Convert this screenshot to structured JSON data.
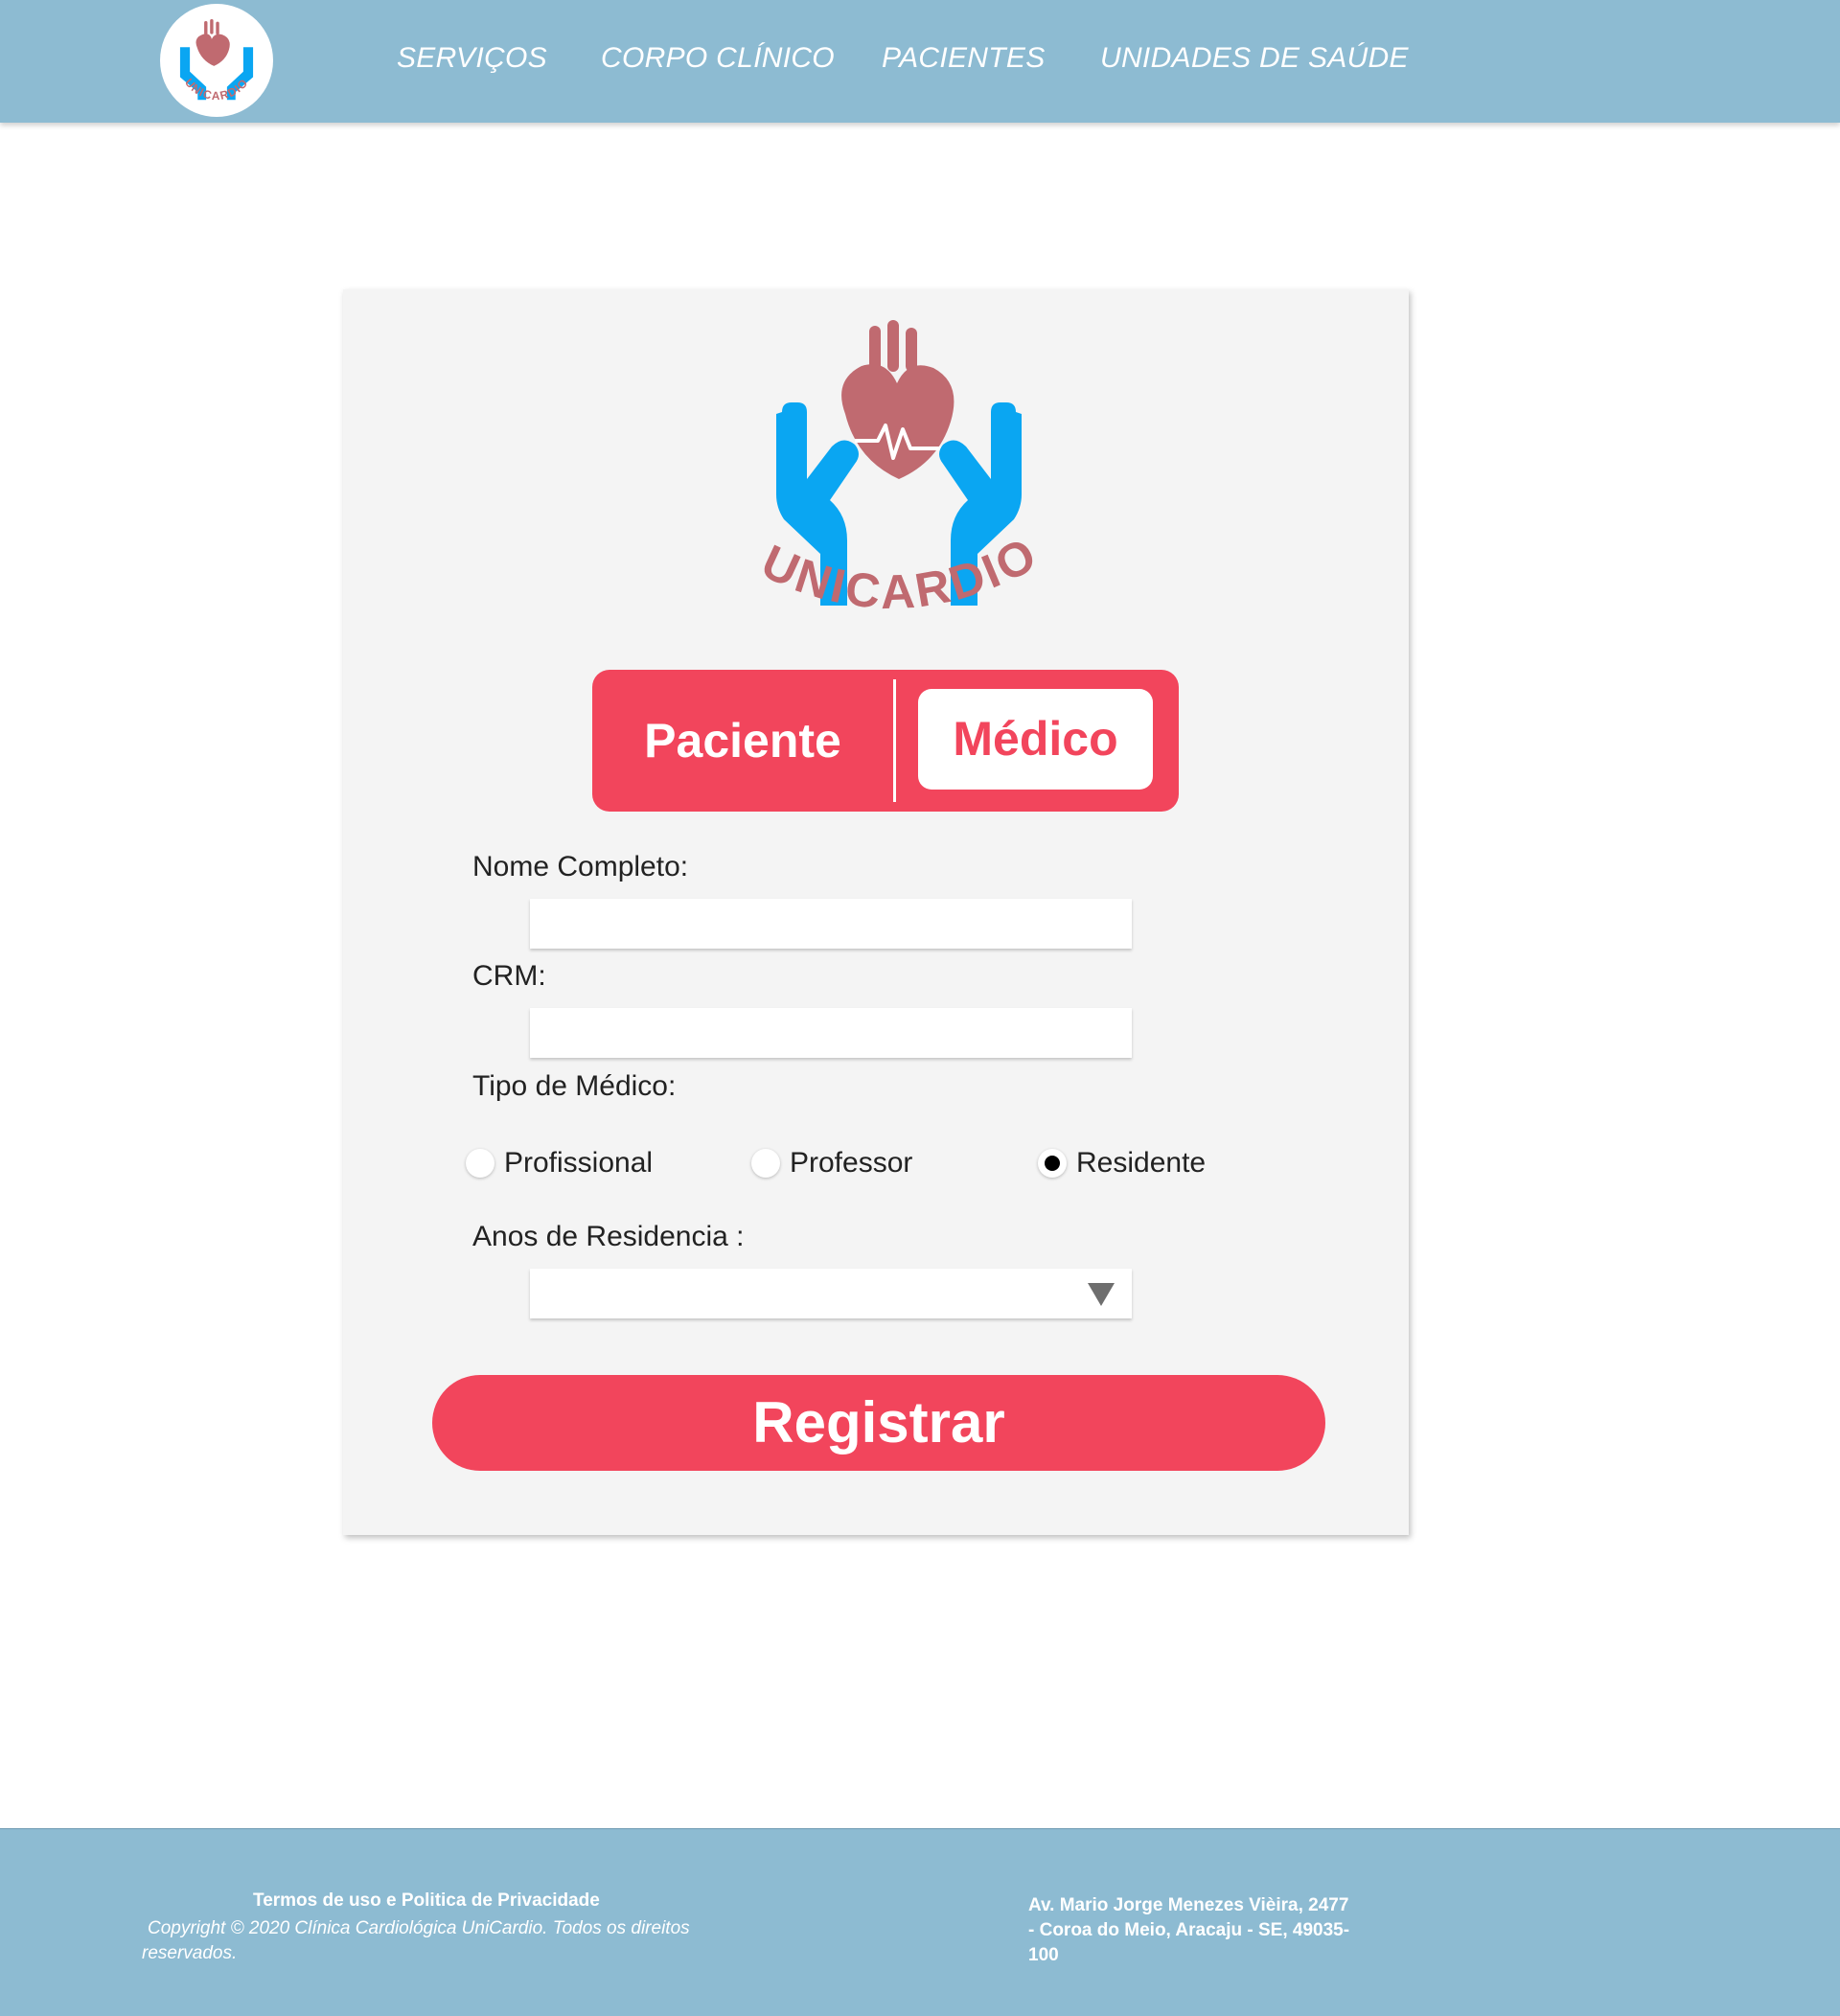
{
  "brand": {
    "logo_text": "UNICARDIO",
    "colors": {
      "heart": "#c06a70",
      "hands": "#0aa6f2",
      "accent": "#f2455c",
      "header_bg": "#8dbbd2",
      "card_bg": "#f4f4f4"
    }
  },
  "nav": {
    "items": [
      {
        "label": "SERVIÇOS"
      },
      {
        "label": "CORPO CLÍNICO"
      },
      {
        "label": "PACIENTES"
      },
      {
        "label": "UNIDADES DE SAÚDE"
      }
    ]
  },
  "form": {
    "role_toggle": {
      "options": [
        {
          "label": "Paciente"
        },
        {
          "label": "Médico"
        }
      ],
      "selected": "Médico"
    },
    "nome": {
      "label": "Nome Completo:",
      "value": "",
      "placeholder": ""
    },
    "crm": {
      "label": "CRM:",
      "value": "",
      "placeholder": ""
    },
    "tipo": {
      "label": "Tipo de Médico:",
      "options": [
        {
          "label": "Profissional",
          "checked": false
        },
        {
          "label": "Professor",
          "checked": false
        },
        {
          "label": "Residente",
          "checked": true
        }
      ]
    },
    "anos": {
      "label": "Anos de Residencia :",
      "selected_value": ""
    },
    "submit_label": "Registrar"
  },
  "footer": {
    "terms": "Termos de uso e Politica de Privacidade",
    "copyright": "Copyright © 2020 Clínica Cardiológica UniCardio. Todos os direitos reservados.",
    "address": "Av. Mario Jorge Menezes Vièira, 2477 - Coroa do Meio, Aracaju - SE, 49035-100"
  }
}
